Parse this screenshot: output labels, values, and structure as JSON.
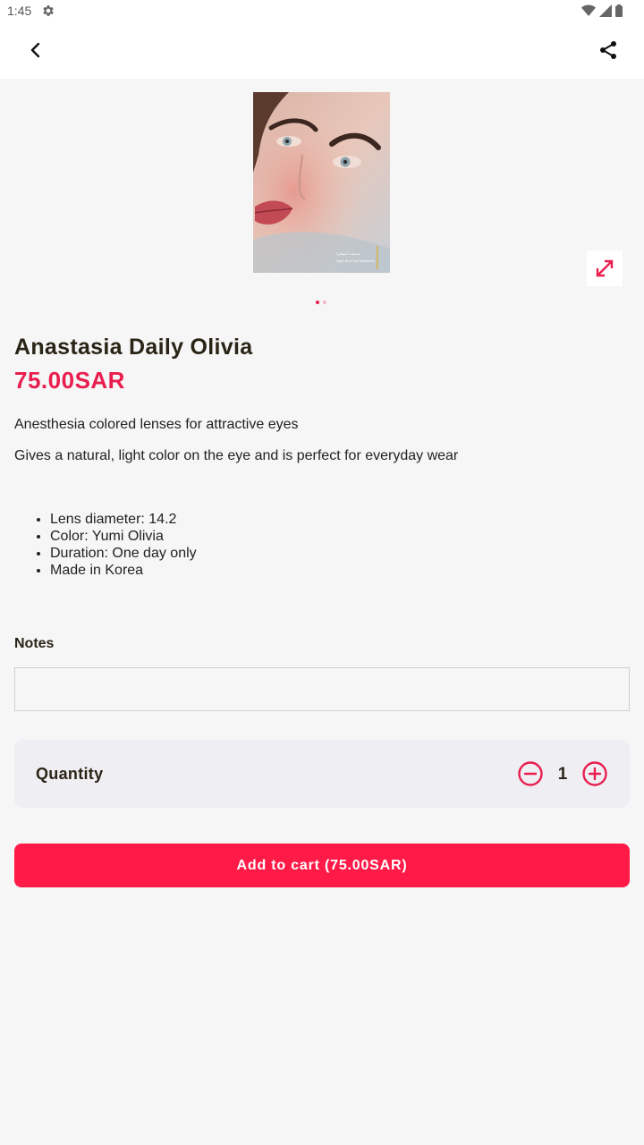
{
  "status_bar": {
    "time": "1:45"
  },
  "product": {
    "title": "Anastasia Daily Olivia",
    "price": "75.00SAR",
    "description_1": "Anesthesia colored lenses for attractive eyes",
    "description_2": "Gives a natural, light color on the eye and is perfect for everyday wear",
    "features": [
      "Lens diameter: 14.2",
      "Color: Yumi Olivia",
      "Duration: One day only",
      "Made in Korea"
    ],
    "image_count": 2,
    "active_image": 1
  },
  "notes": {
    "label": "Notes",
    "value": "",
    "placeholder": ""
  },
  "quantity": {
    "label": "Quantity",
    "value": "1"
  },
  "cart": {
    "button_label": "Add to cart (75.00SAR)"
  },
  "icons": {
    "back": "chevron-left-icon",
    "share": "share-icon",
    "expand": "expand-icon",
    "minus": "minus-circle-icon",
    "plus": "plus-circle-icon"
  },
  "colors": {
    "accent": "#e91e4e",
    "button": "#ff1a47",
    "title": "#2a2416"
  }
}
